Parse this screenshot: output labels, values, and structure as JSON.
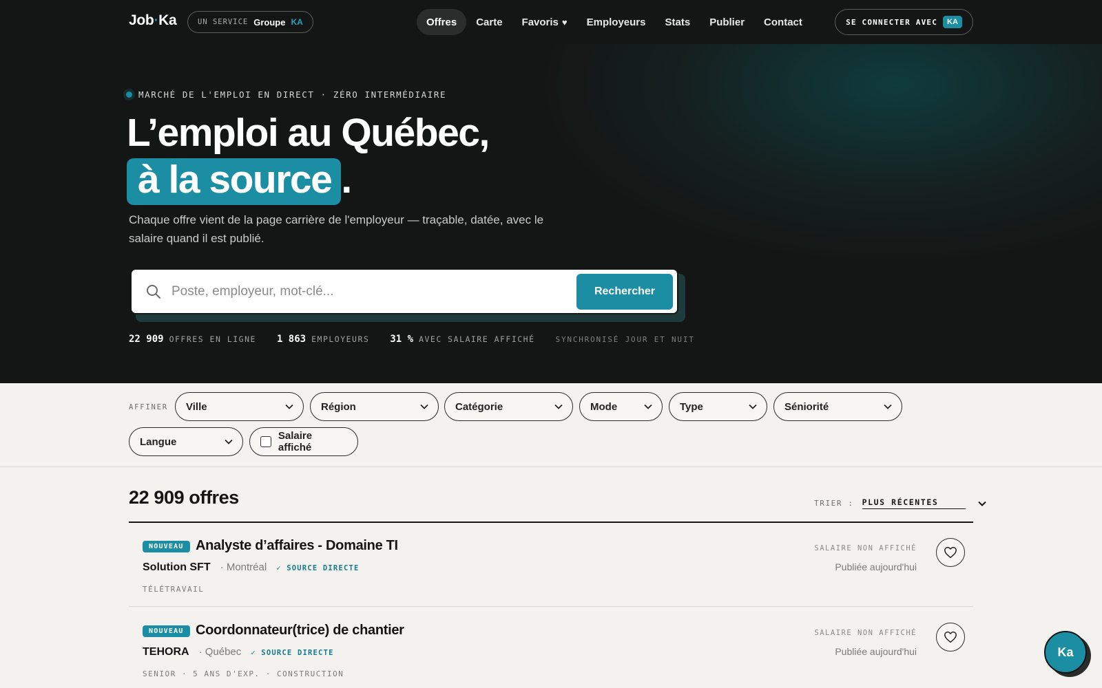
{
  "nav": {
    "logo_pre": "Job",
    "logo_dot": "·",
    "logo_post": "Ka",
    "service_a": "UN SERVICE",
    "service_b": "Groupe",
    "service_c": "KA",
    "items": [
      {
        "label": "Offres",
        "active": true
      },
      {
        "label": "Carte"
      },
      {
        "label": "Favoris"
      },
      {
        "label": "Employeurs"
      },
      {
        "label": "Stats"
      },
      {
        "label": "Publier"
      },
      {
        "label": "Contact"
      }
    ],
    "login_label": "SE CONNECTER AVEC",
    "login_badge": "KA"
  },
  "hero": {
    "kicker": "MARCHÉ DE L'EMPLOI EN DIRECT · ZÉRO INTERMÉDIAIRE",
    "title_line1": "L’emploi au Québec,",
    "title_highlight": "à la source",
    "title_end": ".",
    "subtitle": "Chaque offre vient de la page carrière de l'employeur — traçable, datée, avec le salaire quand il est publié.",
    "search_placeholder": "Poste, employeur, mot-clé...",
    "search_button": "Rechercher",
    "stats": [
      {
        "num": "22 909",
        "label": "OFFRES EN LIGNE"
      },
      {
        "num": "1 863",
        "label": "EMPLOYEURS"
      },
      {
        "num": "31 %",
        "label": "AVEC SALAIRE AFFICHÉ"
      }
    ],
    "sync": "SYNCHRONISÉ JOUR ET NUIT"
  },
  "filters": {
    "label": "AFFINER",
    "selects": [
      "Ville",
      "Région",
      "Catégorie",
      "Mode",
      "Type",
      "Séniorité",
      "Langue"
    ],
    "checkbox_label": "Salaire affiché",
    "checkbox_checked": false
  },
  "results": {
    "title": "22 909 offres",
    "sort_label": "TRIER :",
    "sort_value": "PLUS RÉCENTES",
    "jobs": [
      {
        "badge": "NOUVEAU",
        "title": "Analyste d’affaires - Domaine TI",
        "company": "Solution SFT",
        "city": "· Montréal",
        "source": "✓ SOURCE DIRECTE",
        "tags": "TÉLÉTRAVAIL",
        "salary": "SALAIRE NON AFFICHÉ",
        "published": "Publiée aujourd'hui"
      },
      {
        "badge": "NOUVEAU",
        "title": "Coordonnateur(trice) de chantier",
        "company": "TEHORA",
        "city": "· Québec",
        "source": "✓ SOURCE DIRECTE",
        "tags": "SENIOR · 5 ANS D'EXP. · CONSTRUCTION",
        "salary": "SALAIRE NON AFFICHÉ",
        "published": "Publiée aujourd'hui"
      }
    ]
  },
  "assistant_label": "Ka",
  "colors": {
    "accent": "#1b8ea3",
    "nav_bg": "#141615",
    "page_bg": "#f3f2ee"
  }
}
